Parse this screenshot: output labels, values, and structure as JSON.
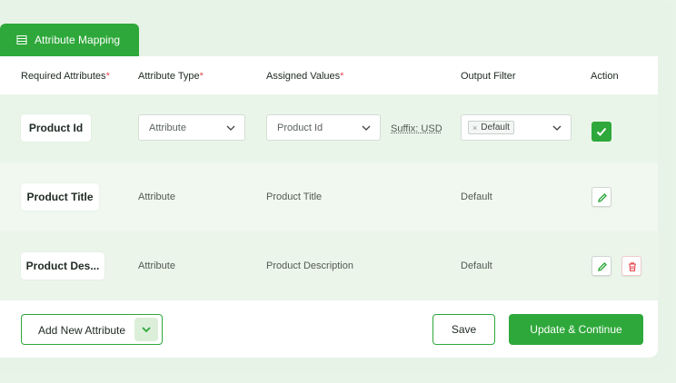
{
  "tab": {
    "title": "Attribute Mapping",
    "icon": "list-icon"
  },
  "columns": {
    "required": "Required Attributes",
    "type": "Attribute Type",
    "assigned": "Assigned Values",
    "filter": "Output Filter",
    "action": "Action",
    "required_mark": "*"
  },
  "rows": [
    {
      "name": "Product Id",
      "type": "Attribute",
      "value": "Product Id",
      "suffix": "Suffix: USD",
      "filter": "Default",
      "tag_remove": "×",
      "editing": true
    },
    {
      "name": "Product Title",
      "type": "Attribute",
      "value": "Product Title",
      "filter": "Default",
      "editing": false
    },
    {
      "name": "Product Des...",
      "type": "Attribute",
      "value": "Product Description",
      "filter": "Default",
      "editing": false
    }
  ],
  "footer": {
    "add_label": "Add New Attribute",
    "save_label": "Save",
    "update_label": "Update & Continue"
  },
  "colors": {
    "accent": "#2ea83a",
    "danger": "#e5484d",
    "background": "#e8f3e7"
  }
}
